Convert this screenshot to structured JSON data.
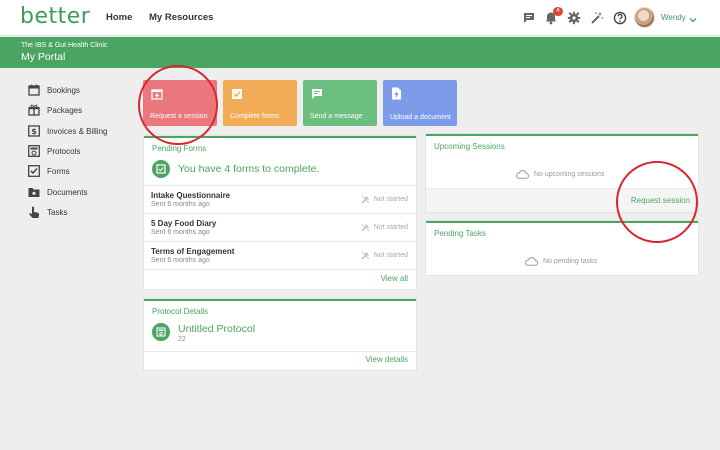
{
  "app": {
    "logo": "better"
  },
  "nav": {
    "home": "Home",
    "resources": "My Resources"
  },
  "topbar": {
    "icons": [
      "chat-icon",
      "bell-icon",
      "gear-icon",
      "magic-wand-icon",
      "help-icon"
    ],
    "notification_count": "4",
    "user_name": "Wendy"
  },
  "header": {
    "clinic": "The IBS & Gut Health Clinic",
    "portal": "My Portal"
  },
  "sidebar": {
    "items": [
      {
        "label": "Bookings",
        "icon": "calendar-icon"
      },
      {
        "label": "Packages",
        "icon": "gift-icon"
      },
      {
        "label": "Invoices & Billing",
        "icon": "dollar-icon"
      },
      {
        "label": "Protocols",
        "icon": "protocol-icon"
      },
      {
        "label": "Forms",
        "icon": "checklist-icon"
      },
      {
        "label": "Documents",
        "icon": "folder-icon"
      },
      {
        "label": "Tasks",
        "icon": "hand-pointer-icon"
      }
    ]
  },
  "tiles": [
    {
      "label": "Request a session",
      "color": "#ea767e"
    },
    {
      "label": "Complete forms",
      "color": "#f2ab57"
    },
    {
      "label": "Send a message",
      "color": "#6cbf7f"
    },
    {
      "label": "Upload a document",
      "color": "#7c9be9"
    }
  ],
  "pending_forms": {
    "title": "Pending Forms",
    "summary": "You have 4 forms to complete.",
    "rows": [
      {
        "name": "Intake Questionnaire",
        "sent": "Sent 6 months ago",
        "status": "Not started"
      },
      {
        "name": "5 Day Food Diary",
        "sent": "Sent 6 months ago",
        "status": "Not started"
      },
      {
        "name": "Terms of Engagement",
        "sent": "Sent 6 months ago",
        "status": "Not started"
      }
    ],
    "view_all": "View all"
  },
  "protocol_details": {
    "title": "Protocol Details",
    "name": "Untitled Protocol",
    "number": "22",
    "view_details": "View details"
  },
  "upcoming_sessions": {
    "title": "Upcoming Sessions",
    "empty": "No upcoming sessions",
    "request": "Request session"
  },
  "pending_tasks": {
    "title": "Pending Tasks",
    "empty": "No pending tasks"
  },
  "colors": {
    "brand": "#4aa563",
    "annotation": "#d9262a"
  }
}
